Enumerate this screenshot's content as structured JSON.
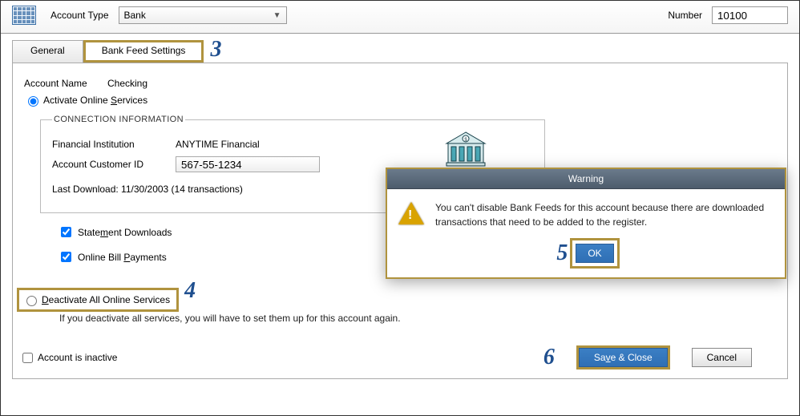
{
  "header": {
    "account_type_label": "Account Type",
    "account_type_value": "Bank",
    "number_label": "Number",
    "number_value": "10100"
  },
  "tabs": {
    "general": "General",
    "bank_feed": "Bank Feed Settings"
  },
  "account_name_label": "Account Name",
  "account_name_value": "Checking",
  "activate_label": "Activate Online Services",
  "connection": {
    "legend": "CONNECTION INFORMATION",
    "fi_label": "Financial Institution",
    "fi_value": "ANYTIME Financial",
    "cust_label": "Account Customer ID",
    "cust_value": "567-55-1234",
    "last_download": "Last Download: 11/30/2003 (14 transactions)"
  },
  "checks": {
    "statement": "Statement Downloads",
    "billpay": "Online Bill Payments"
  },
  "deactivate_label": "Deactivate All Online Services",
  "deactivate_note": "If you deactivate all services, you will have to set them up for this account again.",
  "footer": {
    "inactive_label": "Account is inactive",
    "save": "Save & Close",
    "cancel": "Cancel"
  },
  "dialog": {
    "title": "Warning",
    "message": "You can't disable Bank Feeds for this account because there are downloaded transactions that need to be added to the register.",
    "ok": "OK"
  },
  "steps": {
    "s3": "3",
    "s4": "4",
    "s5": "5",
    "s6": "6"
  }
}
